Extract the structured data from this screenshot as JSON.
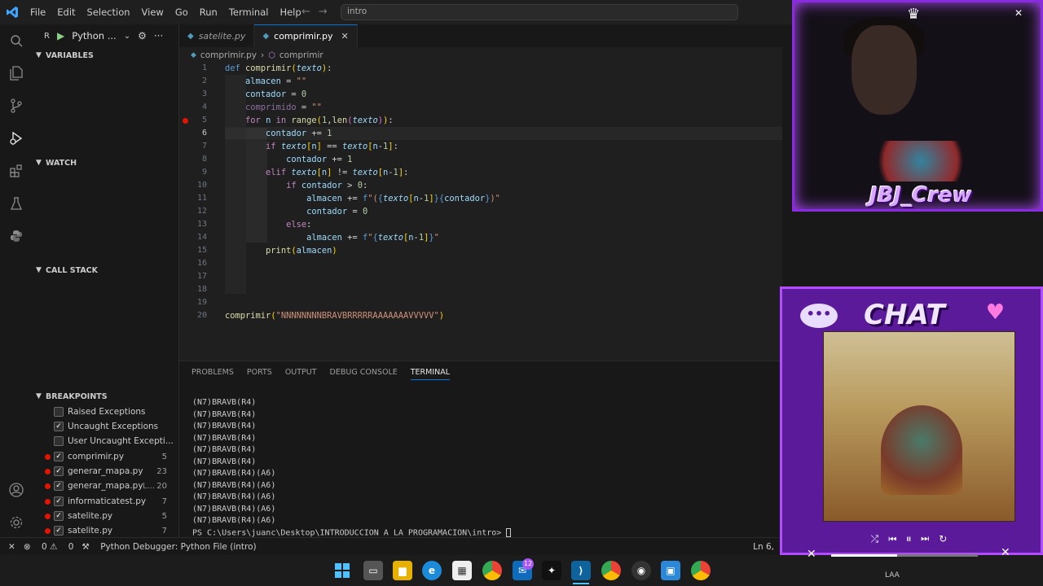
{
  "titlebar": {
    "menu": [
      "File",
      "Edit",
      "Selection",
      "View",
      "Go",
      "Run",
      "Terminal",
      "Help"
    ],
    "search_text": "intro"
  },
  "run": {
    "config_label": "Python ...",
    "letter": "R"
  },
  "sidebar": {
    "variables": "VARIABLES",
    "watch": "WATCH",
    "call_stack": "CALL STACK",
    "breakpoints": "BREAKPOINTS",
    "bp_items": [
      {
        "label": "Raised Exceptions",
        "checked": false,
        "count": ""
      },
      {
        "label": "Uncaught Exceptions",
        "checked": true,
        "count": ""
      },
      {
        "label": "User Uncaught Excepti...",
        "checked": false,
        "count": ""
      },
      {
        "label": "comprimir.py",
        "checked": true,
        "count": "5"
      },
      {
        "label": "generar_mapa.py",
        "checked": true,
        "count": "23"
      },
      {
        "label": "generar_mapa.py",
        "checked": true,
        "count": "20",
        "path": "L..."
      },
      {
        "label": "informaticatest.py",
        "checked": true,
        "count": "7"
      },
      {
        "label": "satelite.py",
        "checked": true,
        "count": "5"
      },
      {
        "label": "satelite.py",
        "checked": true,
        "count": "7"
      }
    ]
  },
  "tabs": [
    {
      "label": "satelite.py",
      "active": false
    },
    {
      "label": "comprimir.py",
      "active": true
    }
  ],
  "breadcrumb": {
    "file": "comprimir.py",
    "symbol": "comprimir"
  },
  "editor": {
    "line_numbers": [
      "1",
      "2",
      "3",
      "4",
      "5",
      "6",
      "7",
      "8",
      "9",
      "10",
      "11",
      "12",
      "13",
      "14",
      "15",
      "16",
      "17",
      "18",
      "19",
      "20"
    ],
    "call_arg": "\"NNNNNNNNBRAVBRRRRRAAAAAAAVVVVV\""
  },
  "panel": {
    "tabs": [
      "PROBLEMS",
      "PORTS",
      "OUTPUT",
      "DEBUG CONSOLE",
      "TERMINAL"
    ],
    "terminal_lines": [
      "(N7)BRAVB(R4)",
      "(N7)BRAVB(R4)",
      "(N7)BRAVB(R4)",
      "(N7)BRAVB(R4)",
      "(N7)BRAVB(R4)",
      "(N7)BRAVB(R4)",
      "(N7)BRAVB(R4)(A6)",
      "(N7)BRAVB(R4)(A6)",
      "(N7)BRAVB(R4)(A6)",
      "(N7)BRAVB(R4)(A6)",
      "(N7)BRAVB(R4)(A6)",
      "PS C:\\Users\\juanc\\Desktop\\INTRODUCCION A LA PROGRAMACION\\intro> "
    ]
  },
  "statusbar": {
    "errors": "0",
    "warnings": "0",
    "debugger": "Python Debugger: Python File (intro)",
    "position": "Ln 6,"
  },
  "overlay": {
    "brand": "JBJ_Crew",
    "chat_title": "CHAT",
    "progress": 0.45
  },
  "taskbar": {
    "badge": "12",
    "clock": "LAA"
  }
}
